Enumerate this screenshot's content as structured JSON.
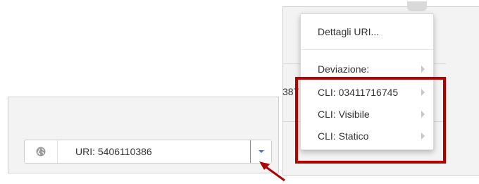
{
  "uri_field": {
    "label": "URI: 5406110386",
    "icon": "globe-icon"
  },
  "dropdown_button": {
    "icon": "caret-down-icon"
  },
  "background_peek": {
    "text": "387"
  },
  "context_menu": {
    "items": [
      {
        "label": "Dettagli URI...",
        "submenu": false
      },
      {
        "label": "Deviazione:",
        "submenu": true
      },
      {
        "label": "CLI: 03411716745",
        "submenu": true
      },
      {
        "label": "CLI: Visibile",
        "submenu": true
      },
      {
        "label": "CLI: Statico",
        "submenu": true
      }
    ]
  },
  "colors": {
    "highlight": "#b00000",
    "accent_blue": "#2f7fd1",
    "panel_bg": "#f3f3f3"
  }
}
